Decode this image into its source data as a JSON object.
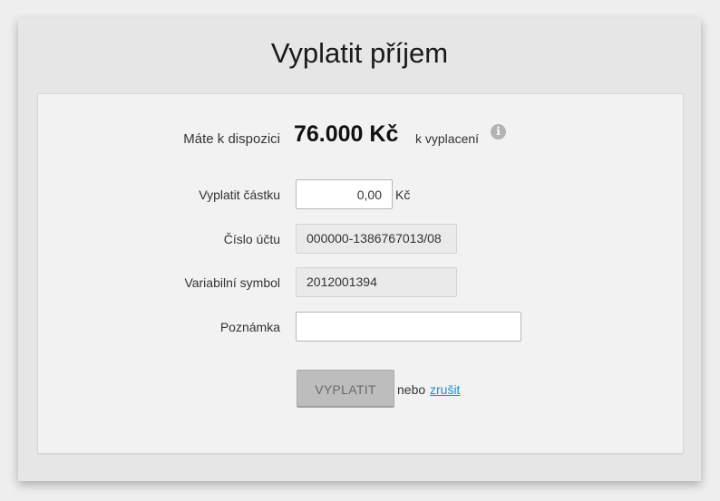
{
  "dialog": {
    "title": "Vyplatit příjem"
  },
  "available": {
    "label": "Máte k dispozici",
    "amount": "76.000 Kč",
    "suffix": "k vyplacení",
    "info_icon": "i"
  },
  "form": {
    "amount": {
      "label": "Vyplatit částku",
      "value": "0,00",
      "currency": "Kč"
    },
    "account": {
      "label": "Číslo účtu",
      "value": "000000-1386767013/08"
    },
    "variable_symbol": {
      "label": "Variabilní symbol",
      "value": "2012001394"
    },
    "note": {
      "label": "Poznámka",
      "value": ""
    }
  },
  "actions": {
    "pay_label": "VYPLATIT",
    "or_text": "nebo",
    "cancel_label": "zrušit"
  },
  "colors": {
    "link": "#1a8fd4",
    "button_bg": "#bdbdbd"
  }
}
